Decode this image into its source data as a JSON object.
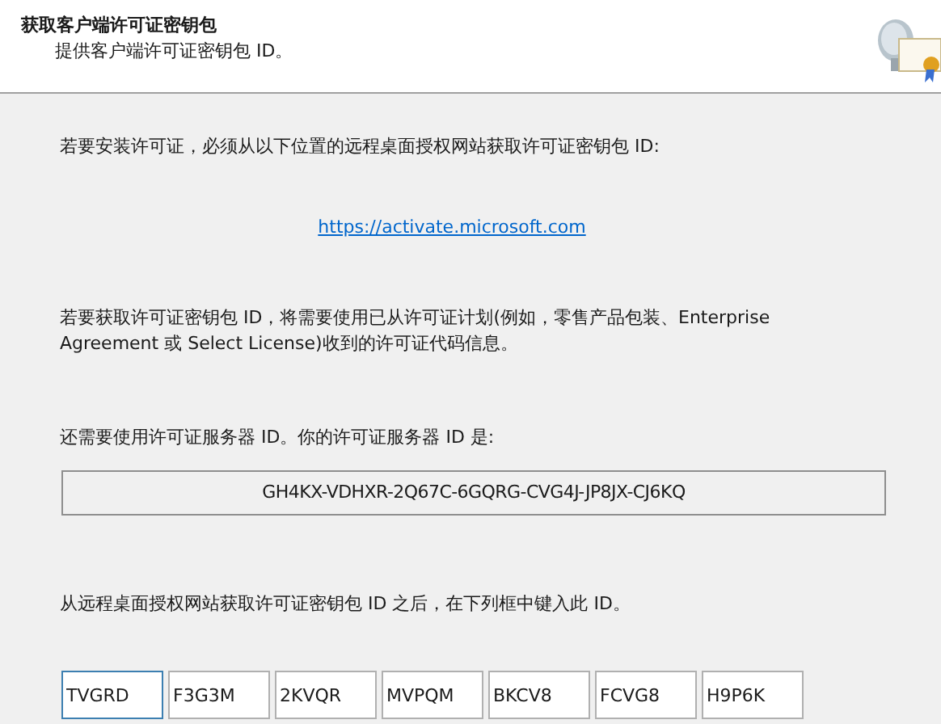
{
  "header": {
    "title": "获取客户端许可证密钥包",
    "subtitle": "提供客户端许可证密钥包 ID。"
  },
  "body": {
    "intro": "若要安装许可证，必须从以下位置的远程桌面授权网站获取许可证密钥包 ID:",
    "link": "https://activate.microsoft.com",
    "info": "若要获取许可证密钥包 ID，将需要使用已从许可证计划(例如，零售产品包装、Enterprise Agreement 或 Select License)收到的许可证代码信息。",
    "server_label": "还需要使用许可证服务器 ID。你的许可证服务器 ID 是:",
    "server_id": "GH4KX-VDHXR-2Q67C-6GQRG-CVG4J-JP8JX-CJ6KQ",
    "entry_label": "从远程桌面授权网站获取许可证密钥包 ID 之后，在下列框中键入此 ID。",
    "key_fields": [
      {
        "value": "TVGRD",
        "focused": true
      },
      {
        "value": "F3G3M",
        "focused": false
      },
      {
        "value": "2KVQR",
        "focused": false
      },
      {
        "value": "MVPQM",
        "focused": false
      },
      {
        "value": "BKCV8",
        "focused": false
      },
      {
        "value": "FCVG8",
        "focused": false
      },
      {
        "value": "H9P6K",
        "focused": false
      }
    ]
  }
}
